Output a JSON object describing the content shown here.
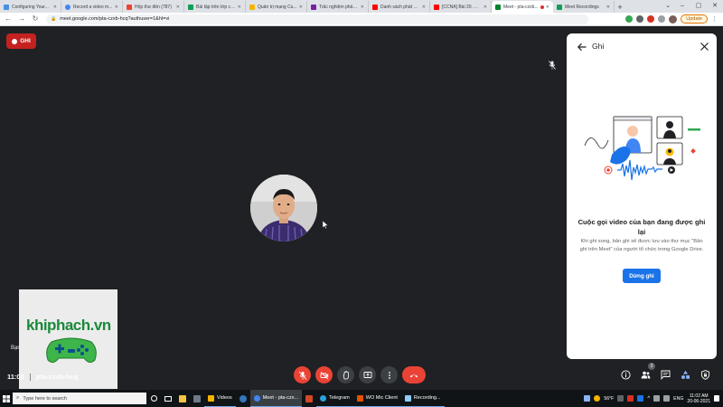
{
  "browser": {
    "tabs": [
      {
        "label": "Configuring Your...",
        "color": "#4a90e2"
      },
      {
        "label": "Record a video m...",
        "color": "#4285f4"
      },
      {
        "label": "Hộp thư đến (787)",
        "color": "#ea4335"
      },
      {
        "label": "Bài tập trên lớp ch...",
        "color": "#0f9d58"
      },
      {
        "label": "Quản trị mạng Cu...",
        "color": "#f4b400"
      },
      {
        "label": "Trắc nghiệm phần...",
        "color": "#7b1fa2"
      },
      {
        "label": "Danh sách phát củ...",
        "color": "#ff0000"
      },
      {
        "label": "[CCNA] Bài 20. Cấu...",
        "color": "#ff0000"
      },
      {
        "label": "Meet - pta-czxb...",
        "color": "#00832d"
      },
      {
        "label": "Meet Recordings",
        "color": "#0f9d58"
      }
    ],
    "new_tab": "+",
    "url": "meet.google.com/pta-czxb-hcq?authuser=1&hl=vi",
    "update_label": "Update"
  },
  "meet": {
    "rec_badge": "GHI",
    "self_name": "Bạn",
    "time": "11:00",
    "meeting_code": "pta-czxb-hcq",
    "logo_text": "khiphach",
    "logo_suffix": ".vn",
    "participants_count": "3",
    "colors": {
      "red": "#ea4335",
      "blue": "#1a73e8",
      "bg": "#202124"
    }
  },
  "panel": {
    "title": "Ghi",
    "heading": "Cuộc gọi video của bạn đang được ghi lại",
    "body": "Khi ghi xong, bản ghi sẽ được lưu vào thư mục \"Bản ghi trên Meet\" của người tổ chức trong Google Drive.",
    "stop_button": "Dừng ghi"
  },
  "taskbar": {
    "search_placeholder": "Type here to search",
    "apps": [
      {
        "label": "Videos",
        "color": "#f4b400",
        "active": false
      },
      {
        "label": "Meet - pta-czx...",
        "color": "#4285f4",
        "active": true
      },
      {
        "label": "Telegram",
        "color": "#2aa3df",
        "active": false
      },
      {
        "label": "WO Mic Client",
        "color": "#e65100",
        "active": false
      },
      {
        "label": "Recording...",
        "color": "#90caf9",
        "active": false
      }
    ],
    "weather": "56°F",
    "language": "ENG",
    "clock_time": "11:02 AM",
    "clock_date": "20-06-2021"
  }
}
